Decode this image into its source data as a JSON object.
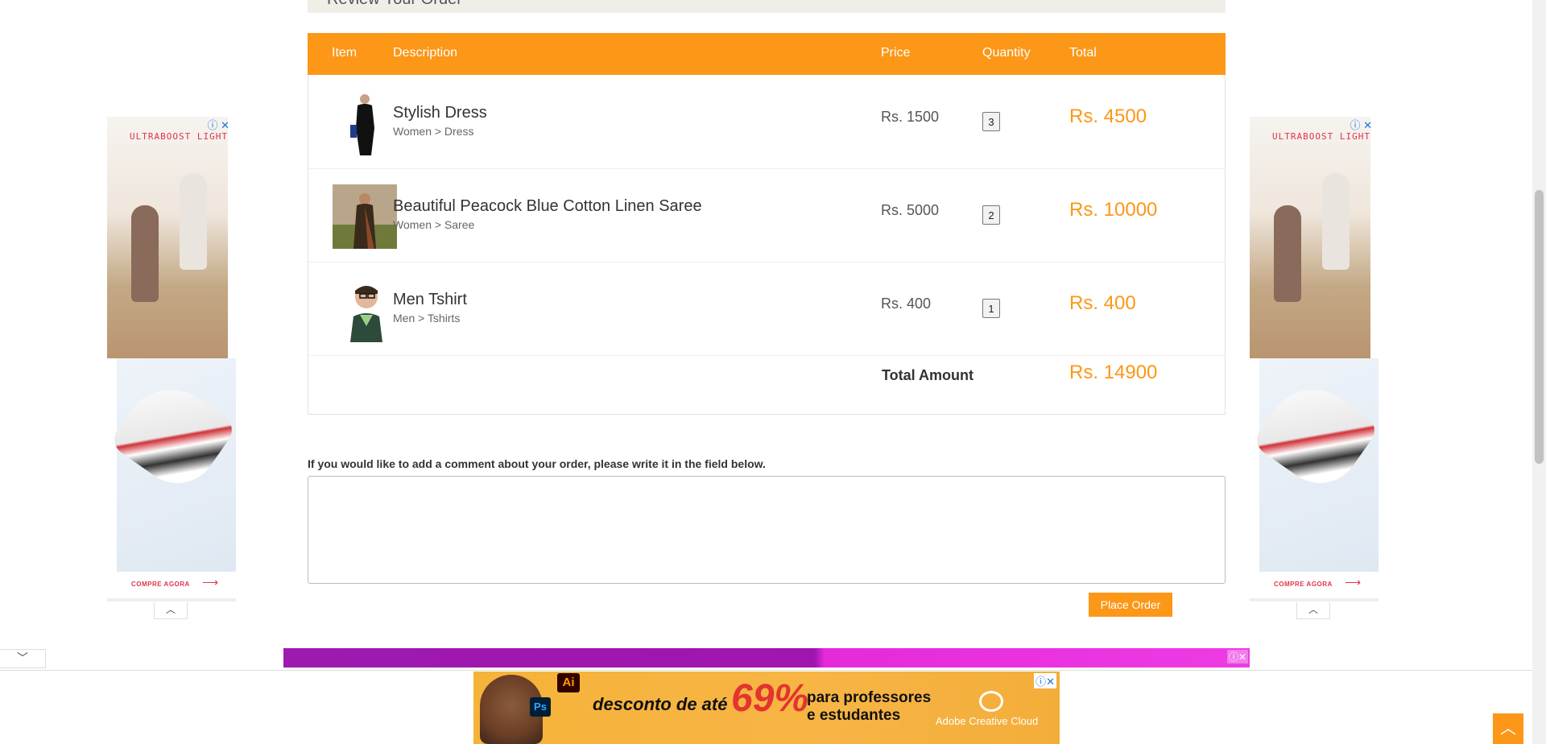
{
  "review": {
    "title": "Review Your Order"
  },
  "table": {
    "headers": {
      "item": "Item",
      "description": "Description",
      "price": "Price",
      "quantity": "Quantity",
      "total": "Total"
    },
    "rows": [
      {
        "name": "Stylish Dress",
        "category": "Women > Dress",
        "price": "Rs. 1500",
        "quantity": "3",
        "total": "Rs. 4500"
      },
      {
        "name": "Beautiful Peacock Blue Cotton Linen Saree",
        "category": "Women > Saree",
        "price": "Rs. 5000",
        "quantity": "2",
        "total": "Rs. 10000"
      },
      {
        "name": "Men Tshirt",
        "category": "Men > Tshirts",
        "price": "Rs. 400",
        "quantity": "1",
        "total": "Rs. 400"
      }
    ],
    "total_label": "Total Amount",
    "total_value": "Rs. 14900"
  },
  "comment": {
    "label": "If you would like to add a comment about your order, please write it in the field below.",
    "value": ""
  },
  "actions": {
    "place_order": "Place Order"
  },
  "ads": {
    "side_left": {
      "title": "ULTRABOOST LIGHT",
      "cta": "COMPRE AGORA",
      "info_icon": "ⓘ",
      "close_icon": "✕"
    },
    "side_right": {
      "title": "ULTRABOOST LIGHT",
      "cta": "COMPRE AGORA",
      "info_icon": "ⓘ",
      "close_icon": "✕"
    },
    "bottom": {
      "app1": "Ai",
      "app2": "Ps",
      "headline1": "desconto de até",
      "headline_big": "69%",
      "headline2_line1": "para professores",
      "headline2_line2": "e estudantes",
      "brand": "Adobe Creative Cloud"
    }
  },
  "colors": {
    "accent": "#fc9717",
    "purple": "#9d1aaf",
    "magenta": "#ee3be4"
  },
  "icons": {
    "collapse_up": "chevron-up-icon",
    "collapse_down": "chevron-down-icon",
    "back_to_top": "chevron-up-icon"
  }
}
